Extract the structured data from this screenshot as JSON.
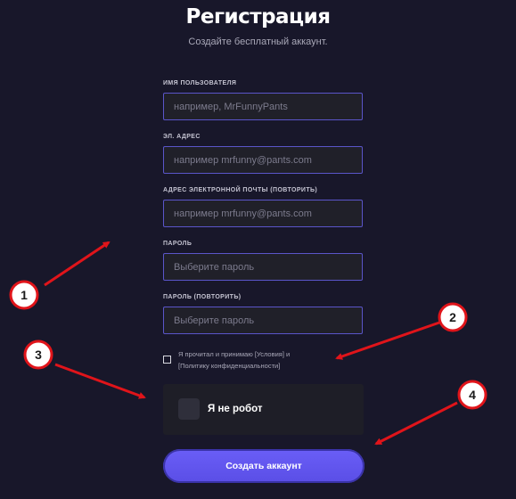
{
  "header": {
    "title": "Регистрация",
    "subtitle": "Создайте бесплатный аккаунт."
  },
  "form": {
    "username": {
      "label": "ИМЯ ПОЛЬЗОВАТЕЛЯ",
      "placeholder": "например, MrFunnyPants",
      "value": ""
    },
    "email": {
      "label": "ЭЛ. АДРЕС",
      "placeholder": "например mrfunny@pants.com",
      "value": ""
    },
    "email_repeat": {
      "label": "АДРЕС ЭЛЕКТРОННОЙ ПОЧТЫ (ПОВТОРИТЬ)",
      "placeholder": "например mrfunny@pants.com",
      "value": ""
    },
    "password": {
      "label": "ПАРОЛЬ",
      "placeholder": "Выберите пароль",
      "value": ""
    },
    "password_repeat": {
      "label": "ПАРОЛЬ (ПОВТОРИТЬ)",
      "placeholder": "Выберите пароль",
      "value": ""
    },
    "terms": {
      "line1": "Я прочитал и принимаю [Условия] и",
      "line2": "[Политику конфиденциальности]",
      "checked": false
    },
    "captcha": {
      "label": "Я не робот",
      "checked": false
    },
    "submit_label": "Создать аккаунт"
  },
  "annotations": {
    "color": "#e0141a",
    "badges": [
      "1",
      "2",
      "3",
      "4"
    ]
  }
}
